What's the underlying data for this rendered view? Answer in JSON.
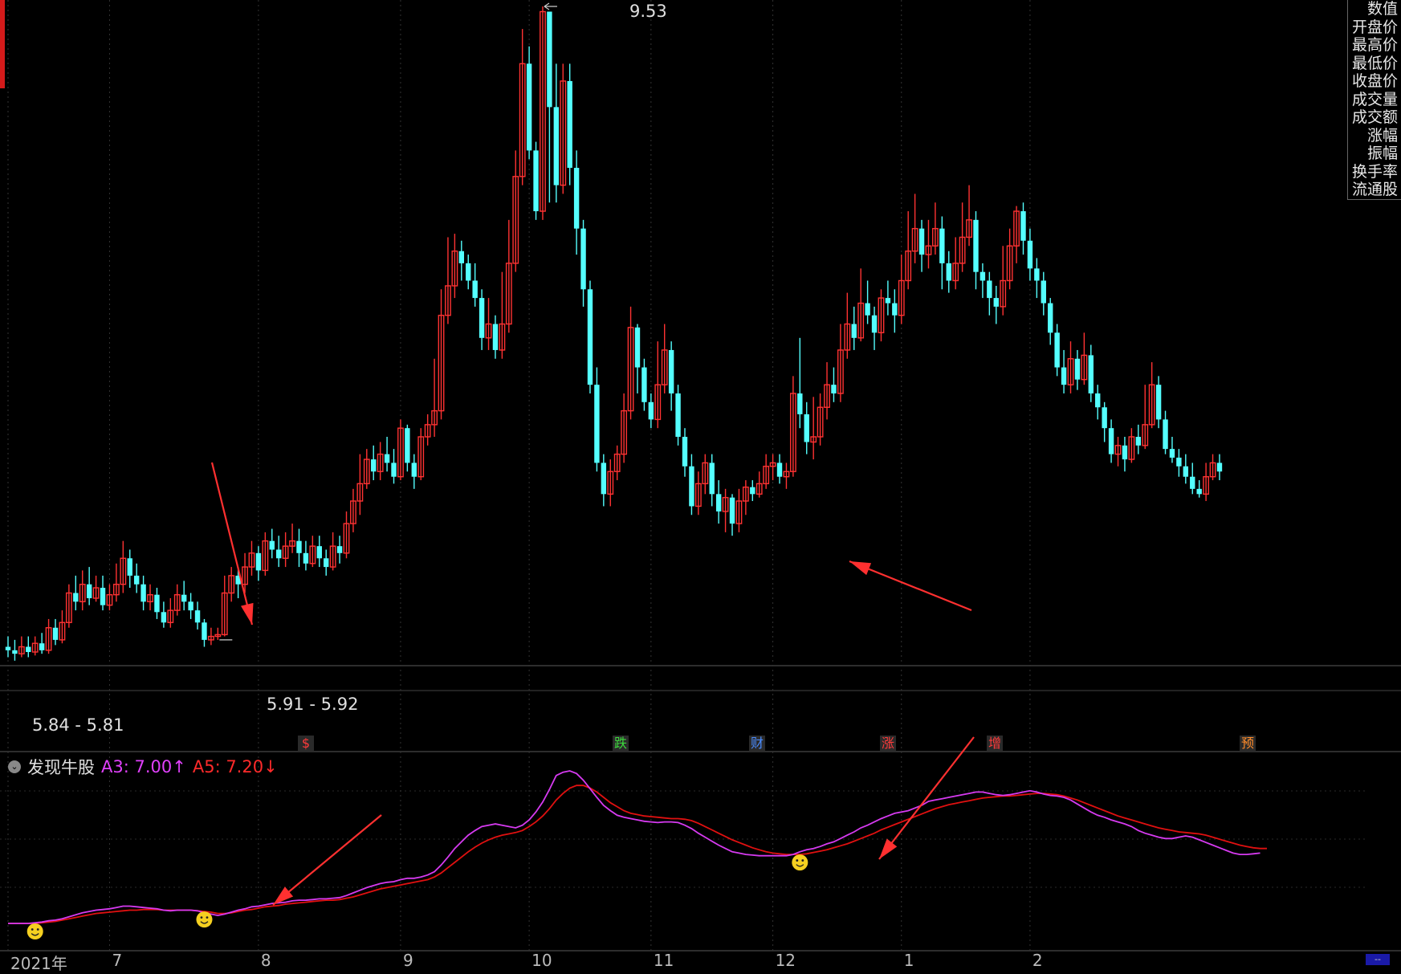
{
  "side_menu": [
    "数值",
    "开盘价",
    "最高价",
    "最低价",
    "收盘价",
    "成交量",
    "成交额",
    "涨幅",
    "振幅",
    "换手率",
    "流通股"
  ],
  "indicator": {
    "name": "发现牛股",
    "a3_label": "A3: 7.00↑",
    "a5_label": "A5: 7.20↓"
  },
  "price_labels": {
    "high": "9.53",
    "low_ref": "5.91 - 5.92",
    "start": "5.84 - 5.81"
  },
  "events": [
    {
      "label": "$",
      "color": "#ff3b3b"
    },
    {
      "label": "跌",
      "color": "#3ddc3d"
    },
    {
      "label": "财",
      "color": "#4a8cff"
    },
    {
      "label": "涨",
      "color": "#ff3b3b"
    },
    {
      "label": "增",
      "color": "#ff3b3b"
    },
    {
      "label": "预",
      "color": "#ff8c2a"
    }
  ],
  "x_labels": [
    "2021年",
    "7",
    "8",
    "9",
    "10",
    "11",
    "12",
    "1",
    "2"
  ],
  "bottom_button": "--",
  "colors": {
    "up": "#ff3232",
    "down": "#54ffff",
    "a3": "#d63af0",
    "a5": "#e01010",
    "arrow": "#ff3030"
  },
  "chart_data": {
    "type": "candlestick",
    "price_range": [
      5.6,
      9.6
    ],
    "candles": [
      [
        5.84,
        5.82,
        5.9,
        5.78
      ],
      [
        5.82,
        5.8,
        5.88,
        5.76
      ],
      [
        5.8,
        5.84,
        5.9,
        5.78
      ],
      [
        5.84,
        5.81,
        5.9,
        5.78
      ],
      [
        5.81,
        5.86,
        5.9,
        5.79
      ],
      [
        5.86,
        5.82,
        5.92,
        5.8
      ],
      [
        5.82,
        5.95,
        6.0,
        5.8
      ],
      [
        5.95,
        5.88,
        6.0,
        5.85
      ],
      [
        5.88,
        5.98,
        6.05,
        5.86
      ],
      [
        5.98,
        6.15,
        6.2,
        5.95
      ],
      [
        6.15,
        6.1,
        6.25,
        6.05
      ],
      [
        6.1,
        6.2,
        6.28,
        6.05
      ],
      [
        6.2,
        6.12,
        6.3,
        6.08
      ],
      [
        6.12,
        6.18,
        6.25,
        6.1
      ],
      [
        6.18,
        6.08,
        6.25,
        6.05
      ],
      [
        6.08,
        6.14,
        6.2,
        6.05
      ],
      [
        6.14,
        6.2,
        6.32,
        6.1
      ],
      [
        6.2,
        6.35,
        6.45,
        6.15
      ],
      [
        6.35,
        6.25,
        6.4,
        6.18
      ],
      [
        6.25,
        6.2,
        6.32,
        6.15
      ],
      [
        6.2,
        6.1,
        6.25,
        6.05
      ],
      [
        6.1,
        6.14,
        6.2,
        6.05
      ],
      [
        6.14,
        6.04,
        6.18,
        6.0
      ],
      [
        6.04,
        5.98,
        6.1,
        5.95
      ],
      [
        5.98,
        6.05,
        6.12,
        5.95
      ],
      [
        6.05,
        6.14,
        6.2,
        6.02
      ],
      [
        6.14,
        6.1,
        6.22,
        6.05
      ],
      [
        6.1,
        6.05,
        6.15,
        6.0
      ],
      [
        6.05,
        5.98,
        6.1,
        5.94
      ],
      [
        5.98,
        5.88,
        6.0,
        5.84
      ],
      [
        5.88,
        5.9,
        5.95,
        5.85
      ],
      [
        5.9,
        5.91,
        5.95,
        5.88
      ],
      [
        5.91,
        6.15,
        6.25,
        5.9
      ],
      [
        6.15,
        6.25,
        6.3,
        6.1
      ],
      [
        6.25,
        6.2,
        6.3,
        6.12
      ],
      [
        6.2,
        6.3,
        6.38,
        6.15
      ],
      [
        6.3,
        6.38,
        6.45,
        6.25
      ],
      [
        6.38,
        6.28,
        6.42,
        6.22
      ],
      [
        6.28,
        6.45,
        6.5,
        6.25
      ],
      [
        6.45,
        6.4,
        6.52,
        6.35
      ],
      [
        6.4,
        6.35,
        6.48,
        6.3
      ],
      [
        6.35,
        6.42,
        6.5,
        6.3
      ],
      [
        6.42,
        6.45,
        6.55,
        6.38
      ],
      [
        6.45,
        6.38,
        6.52,
        6.3
      ],
      [
        6.38,
        6.32,
        6.45,
        6.28
      ],
      [
        6.32,
        6.42,
        6.48,
        6.3
      ],
      [
        6.42,
        6.35,
        6.48,
        6.3
      ],
      [
        6.35,
        6.3,
        6.4,
        6.25
      ],
      [
        6.3,
        6.42,
        6.5,
        6.28
      ],
      [
        6.42,
        6.38,
        6.48,
        6.32
      ],
      [
        6.38,
        6.55,
        6.62,
        6.35
      ],
      [
        6.55,
        6.68,
        6.75,
        6.5
      ],
      [
        6.68,
        6.78,
        6.95,
        6.6
      ],
      [
        6.78,
        6.92,
        6.98,
        6.75
      ],
      [
        6.92,
        6.85,
        7.0,
        6.8
      ],
      [
        6.85,
        6.95,
        7.02,
        6.8
      ],
      [
        6.95,
        6.9,
        7.05,
        6.85
      ],
      [
        6.9,
        6.82,
        6.98,
        6.78
      ],
      [
        6.82,
        7.1,
        7.15,
        6.8
      ],
      [
        7.1,
        6.9,
        7.12,
        6.85
      ],
      [
        6.9,
        6.82,
        6.95,
        6.75
      ],
      [
        6.82,
        7.05,
        7.1,
        6.8
      ],
      [
        7.05,
        7.12,
        7.18,
        7.0
      ],
      [
        7.12,
        7.2,
        7.5,
        7.05
      ],
      [
        7.2,
        7.75,
        7.9,
        7.15
      ],
      [
        7.75,
        7.92,
        8.2,
        7.7
      ],
      [
        7.92,
        8.12,
        8.22,
        7.85
      ],
      [
        8.12,
        8.05,
        8.18,
        7.95
      ],
      [
        8.05,
        7.95,
        8.1,
        7.9
      ],
      [
        7.95,
        7.85,
        8.05,
        7.8
      ],
      [
        7.85,
        7.62,
        7.9,
        7.55
      ],
      [
        7.62,
        7.7,
        7.85,
        7.55
      ],
      [
        7.7,
        7.55,
        7.75,
        7.5
      ],
      [
        7.55,
        7.7,
        8.0,
        7.5
      ],
      [
        7.7,
        8.05,
        8.3,
        7.65
      ],
      [
        8.05,
        8.55,
        8.7,
        8.0
      ],
      [
        8.55,
        9.2,
        9.4,
        8.5
      ],
      [
        9.2,
        8.7,
        9.3,
        8.65
      ],
      [
        8.7,
        8.35,
        8.75,
        8.3
      ],
      [
        8.35,
        9.5,
        9.53,
        8.3
      ],
      [
        9.5,
        8.95,
        9.5,
        8.4
      ],
      [
        8.95,
        8.5,
        9.2,
        8.4
      ],
      [
        8.5,
        9.1,
        9.2,
        8.45
      ],
      [
        9.1,
        8.6,
        9.2,
        8.5
      ],
      [
        8.6,
        8.25,
        8.7,
        8.1
      ],
      [
        8.25,
        7.9,
        8.3,
        7.8
      ],
      [
        7.9,
        7.35,
        7.95,
        7.3
      ],
      [
        7.35,
        6.9,
        7.45,
        6.85
      ],
      [
        6.9,
        6.72,
        6.95,
        6.65
      ],
      [
        6.72,
        6.85,
        6.92,
        6.65
      ],
      [
        6.85,
        6.95,
        7.0,
        6.8
      ],
      [
        6.95,
        7.2,
        7.3,
        6.9
      ],
      [
        7.2,
        7.68,
        7.8,
        7.15
      ],
      [
        7.68,
        7.45,
        7.7,
        7.3
      ],
      [
        7.45,
        7.25,
        7.5,
        7.2
      ],
      [
        7.25,
        7.15,
        7.3,
        7.1
      ],
      [
        7.15,
        7.35,
        7.6,
        7.1
      ],
      [
        7.35,
        7.55,
        7.7,
        7.3
      ],
      [
        7.55,
        7.3,
        7.6,
        7.2
      ],
      [
        7.3,
        7.05,
        7.35,
        7.0
      ],
      [
        7.05,
        6.88,
        7.1,
        6.82
      ],
      [
        6.88,
        6.65,
        6.95,
        6.6
      ],
      [
        6.65,
        6.78,
        6.85,
        6.6
      ],
      [
        6.78,
        6.9,
        6.95,
        6.72
      ],
      [
        6.9,
        6.72,
        6.95,
        6.65
      ],
      [
        6.72,
        6.62,
        6.8,
        6.55
      ],
      [
        6.62,
        6.7,
        6.75,
        6.5
      ],
      [
        6.7,
        6.55,
        6.72,
        6.48
      ],
      [
        6.55,
        6.68,
        6.75,
        6.5
      ],
      [
        6.68,
        6.76,
        6.8,
        6.6
      ],
      [
        6.76,
        6.72,
        6.8,
        6.68
      ],
      [
        6.72,
        6.78,
        6.85,
        6.7
      ],
      [
        6.78,
        6.88,
        6.95,
        6.75
      ],
      [
        6.88,
        6.9,
        6.95,
        6.8
      ],
      [
        6.9,
        6.82,
        6.95,
        6.78
      ],
      [
        6.82,
        6.85,
        6.9,
        6.75
      ],
      [
        6.85,
        7.3,
        7.4,
        6.82
      ],
      [
        7.3,
        7.18,
        7.62,
        7.1
      ],
      [
        7.18,
        7.02,
        7.25,
        6.95
      ],
      [
        7.02,
        7.05,
        7.28,
        6.92
      ],
      [
        7.05,
        7.22,
        7.3,
        7.0
      ],
      [
        7.22,
        7.35,
        7.48,
        7.15
      ],
      [
        7.35,
        7.3,
        7.45,
        7.25
      ],
      [
        7.3,
        7.55,
        7.7,
        7.25
      ],
      [
        7.55,
        7.7,
        7.88,
        7.5
      ],
      [
        7.7,
        7.62,
        7.8,
        7.55
      ],
      [
        7.62,
        7.82,
        8.02,
        7.6
      ],
      [
        7.82,
        7.75,
        7.95,
        7.7
      ],
      [
        7.75,
        7.65,
        7.8,
        7.55
      ],
      [
        7.65,
        7.85,
        7.9,
        7.6
      ],
      [
        7.85,
        7.82,
        7.95,
        7.75
      ],
      [
        7.82,
        7.75,
        7.9,
        7.65
      ],
      [
        7.75,
        7.95,
        8.1,
        7.7
      ],
      [
        7.95,
        8.12,
        8.35,
        7.9
      ],
      [
        8.12,
        8.25,
        8.45,
        8.05
      ],
      [
        8.25,
        8.1,
        8.3,
        8.0
      ],
      [
        8.1,
        8.15,
        8.3,
        8.02
      ],
      [
        8.15,
        8.25,
        8.4,
        8.1
      ],
      [
        8.25,
        8.05,
        8.32,
        7.9
      ],
      [
        8.05,
        7.95,
        8.12,
        7.88
      ],
      [
        7.95,
        8.05,
        8.2,
        7.9
      ],
      [
        8.05,
        8.2,
        8.4,
        8.0
      ],
      [
        8.2,
        8.3,
        8.5,
        8.15
      ],
      [
        8.3,
        8.0,
        8.35,
        7.9
      ],
      [
        8.0,
        7.95,
        8.05,
        7.85
      ],
      [
        7.95,
        7.85,
        8.0,
        7.75
      ],
      [
        7.85,
        7.8,
        7.92,
        7.7
      ],
      [
        7.8,
        7.95,
        8.15,
        7.75
      ],
      [
        7.95,
        8.15,
        8.25,
        7.9
      ],
      [
        8.15,
        8.35,
        8.38,
        8.05
      ],
      [
        8.35,
        8.18,
        8.4,
        8.1
      ],
      [
        8.18,
        8.02,
        8.25,
        7.95
      ],
      [
        8.02,
        7.95,
        8.08,
        7.85
      ],
      [
        7.95,
        7.82,
        8.0,
        7.75
      ],
      [
        7.82,
        7.65,
        7.85,
        7.58
      ],
      [
        7.65,
        7.45,
        7.7,
        7.4
      ],
      [
        7.45,
        7.35,
        7.55,
        7.3
      ],
      [
        7.35,
        7.5,
        7.6,
        7.3
      ],
      [
        7.5,
        7.38,
        7.55,
        7.32
      ],
      [
        7.38,
        7.52,
        7.65,
        7.35
      ],
      [
        7.52,
        7.3,
        7.58,
        7.25
      ],
      [
        7.3,
        7.22,
        7.35,
        7.15
      ],
      [
        7.22,
        7.1,
        7.25,
        7.02
      ],
      [
        7.1,
        6.95,
        7.15,
        6.9
      ],
      [
        6.95,
        7.0,
        7.05,
        6.88
      ],
      [
        7.0,
        6.92,
        7.05,
        6.85
      ],
      [
        6.92,
        7.05,
        7.1,
        6.9
      ],
      [
        7.05,
        7.0,
        7.12,
        6.95
      ],
      [
        7.0,
        7.12,
        7.35,
        6.98
      ],
      [
        7.12,
        7.35,
        7.48,
        7.1
      ],
      [
        7.35,
        7.15,
        7.4,
        7.1
      ],
      [
        7.15,
        6.98,
        7.2,
        6.95
      ],
      [
        6.98,
        6.93,
        7.05,
        6.9
      ],
      [
        6.93,
        6.88,
        6.98,
        6.82
      ],
      [
        6.88,
        6.82,
        6.95,
        6.78
      ],
      [
        6.82,
        6.75,
        6.9,
        6.72
      ],
      [
        6.75,
        6.72,
        6.8,
        6.7
      ],
      [
        6.72,
        6.82,
        6.9,
        6.68
      ],
      [
        6.82,
        6.9,
        6.95,
        6.8
      ],
      [
        6.9,
        6.85,
        6.95,
        6.8
      ]
    ],
    "a3": [
      5.82,
      5.82,
      5.82,
      5.82,
      5.83,
      5.84,
      5.86,
      5.87,
      5.89,
      5.92,
      5.95,
      5.98,
      6.0,
      6.02,
      6.03,
      6.04,
      6.06,
      6.08,
      6.08,
      6.07,
      6.06,
      6.05,
      6.04,
      6.02,
      6.01,
      6.02,
      6.02,
      6.02,
      6.01,
      5.98,
      5.96,
      5.94,
      5.96,
      5.99,
      6.02,
      6.04,
      6.07,
      6.08,
      6.1,
      6.12,
      6.13,
      6.14,
      6.16,
      6.17,
      6.17,
      6.18,
      6.19,
      6.19,
      6.2,
      6.21,
      6.24,
      6.28,
      6.32,
      6.36,
      6.39,
      6.42,
      6.44,
      6.45,
      6.48,
      6.5,
      6.5,
      6.52,
      6.55,
      6.6,
      6.7,
      6.82,
      6.95,
      7.05,
      7.15,
      7.22,
      7.28,
      7.3,
      7.32,
      7.3,
      7.28,
      7.26,
      7.3,
      7.38,
      7.5,
      7.65,
      7.84,
      8.05,
      8.1,
      8.12,
      8.08,
      7.98,
      7.85,
      7.72,
      7.6,
      7.52,
      7.45,
      7.42,
      7.4,
      7.38,
      7.36,
      7.35,
      7.34,
      7.35,
      7.35,
      7.34,
      7.3,
      7.25,
      7.18,
      7.12,
      7.06,
      7.0,
      6.95,
      6.9,
      6.88,
      6.86,
      6.85,
      6.84,
      6.84,
      6.84,
      6.84,
      6.84,
      6.86,
      6.9,
      6.93,
      6.95,
      6.98,
      7.02,
      7.05,
      7.1,
      7.15,
      7.2,
      7.26,
      7.3,
      7.35,
      7.4,
      7.44,
      7.48,
      7.5,
      7.52,
      7.56,
      7.6,
      7.66,
      7.68,
      7.7,
      7.72,
      7.74,
      7.76,
      7.78,
      7.8,
      7.8,
      7.78,
      7.76,
      7.75,
      7.76,
      7.78,
      7.8,
      7.82,
      7.8,
      7.77,
      7.75,
      7.74,
      7.72,
      7.68,
      7.62,
      7.56,
      7.5,
      7.45,
      7.42,
      7.38,
      7.35,
      7.32,
      7.28,
      7.22,
      7.18,
      7.15,
      7.12,
      7.1,
      7.1,
      7.12,
      7.14,
      7.12,
      7.08,
      7.04,
      7.0,
      6.96,
      6.92,
      6.88,
      6.86,
      6.86,
      6.87,
      6.88
    ],
    "a5": [
      5.82,
      5.82,
      5.82,
      5.82,
      5.82,
      5.83,
      5.84,
      5.85,
      5.87,
      5.89,
      5.91,
      5.93,
      5.95,
      5.97,
      5.98,
      5.99,
      6.0,
      6.01,
      6.02,
      6.02,
      6.03,
      6.03,
      6.03,
      6.02,
      6.02,
      6.02,
      6.02,
      6.02,
      6.01,
      6.0,
      5.99,
      5.97,
      5.97,
      5.98,
      6.0,
      6.02,
      6.03,
      6.05,
      6.07,
      6.08,
      6.09,
      6.11,
      6.12,
      6.13,
      6.14,
      6.15,
      6.16,
      6.17,
      6.17,
      6.18,
      6.2,
      6.22,
      6.25,
      6.28,
      6.31,
      6.34,
      6.36,
      6.38,
      6.4,
      6.42,
      6.44,
      6.46,
      6.48,
      6.52,
      6.58,
      6.66,
      6.74,
      6.82,
      6.9,
      6.97,
      7.03,
      7.08,
      7.12,
      7.15,
      7.17,
      7.19,
      7.22,
      7.28,
      7.35,
      7.44,
      7.55,
      7.68,
      7.78,
      7.86,
      7.9,
      7.9,
      7.86,
      7.8,
      7.72,
      7.64,
      7.58,
      7.52,
      7.48,
      7.46,
      7.44,
      7.43,
      7.42,
      7.41,
      7.4,
      7.4,
      7.39,
      7.37,
      7.33,
      7.28,
      7.23,
      7.18,
      7.13,
      7.08,
      7.04,
      7.0,
      6.96,
      6.93,
      6.9,
      6.88,
      6.87,
      6.86,
      6.86,
      6.86,
      6.87,
      6.89,
      6.91,
      6.93,
      6.96,
      6.99,
      7.02,
      7.06,
      7.1,
      7.14,
      7.18,
      7.23,
      7.27,
      7.31,
      7.35,
      7.39,
      7.43,
      7.47,
      7.51,
      7.55,
      7.58,
      7.61,
      7.63,
      7.65,
      7.67,
      7.69,
      7.71,
      7.72,
      7.73,
      7.74,
      7.74,
      7.75,
      7.76,
      7.77,
      7.78,
      7.78,
      7.77,
      7.76,
      7.74,
      7.71,
      7.68,
      7.64,
      7.6,
      7.56,
      7.52,
      7.48,
      7.44,
      7.41,
      7.38,
      7.35,
      7.32,
      7.29,
      7.26,
      7.24,
      7.22,
      7.2,
      7.19,
      7.18,
      7.17,
      7.15,
      7.12,
      7.09,
      7.06,
      7.03,
      7.0,
      6.98,
      6.96,
      6.95,
      6.95
    ],
    "ind_range": [
      5.8,
      8.4
    ],
    "high_index": 79,
    "low_index": 31,
    "smile_indices": [
      4,
      29,
      117
    ],
    "x_label_indices": [
      0,
      15,
      37,
      58,
      77,
      95,
      113,
      132,
      151
    ]
  }
}
